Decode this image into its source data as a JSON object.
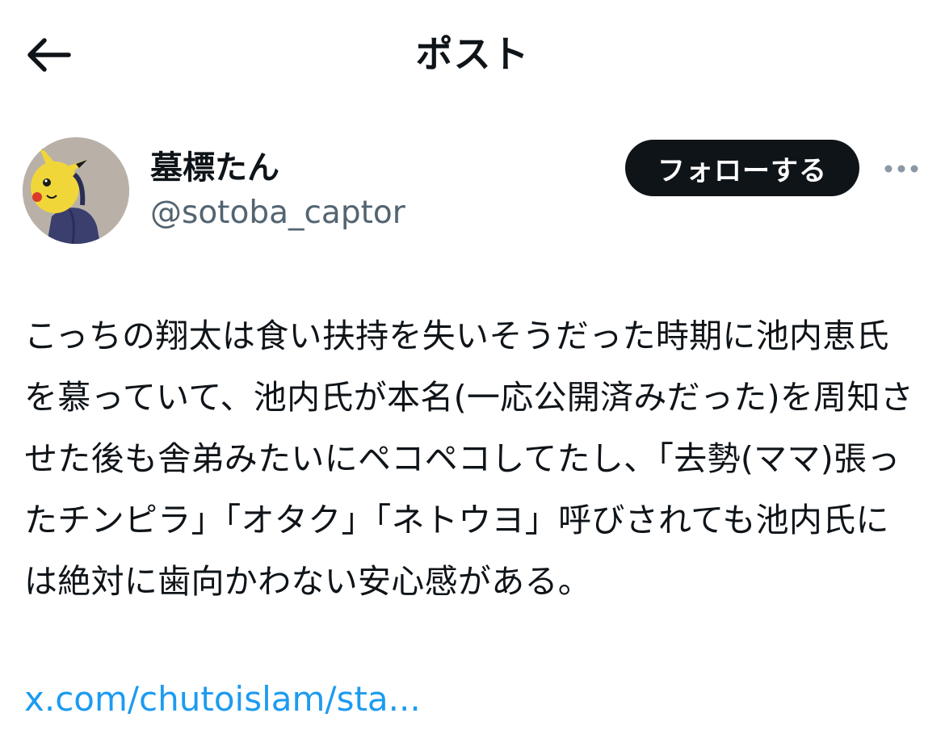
{
  "header": {
    "title": "ポスト",
    "back_icon": "arrow-left-icon"
  },
  "author": {
    "display_name": "墓標たん",
    "handle": "@sotoba_captor",
    "follow_label": "フォローする",
    "more_icon": "more-horizontal-icon",
    "avatar_icon": "avatar-image"
  },
  "post": {
    "text": "こっちの翔太は食い扶持を失いそうだった時期に池内恵氏を慕っていて、池内氏が本名(一応公開済みだった)を周知させた後も舎弟みたいにペコペコしてたし、「去勢(ママ)張ったチンピラ」「オタク」「ネトウヨ」呼びされても池内氏には絶対に歯向かわない安心感がある。",
    "link": "x.com/chutoislam/sta..."
  },
  "colors": {
    "text_primary": "#0f1419",
    "text_secondary": "#536471",
    "link": "#1d9bf0",
    "button_bg": "#0f1419",
    "background": "#ffffff"
  }
}
